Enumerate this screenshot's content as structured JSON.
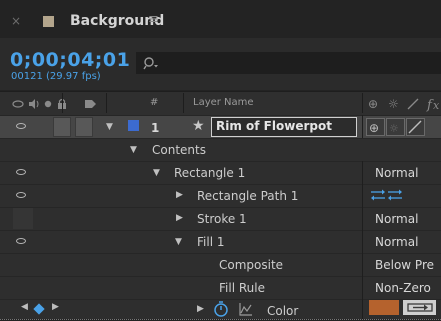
{
  "panel": {
    "close_glyph": "×",
    "title": "Background",
    "menu_glyph": "≡"
  },
  "timecode": {
    "current": "0;00;04;01",
    "frames": "00121 (29.97 fps)"
  },
  "search": {
    "icon": "search-icon",
    "glyph": "⌕"
  },
  "columns": {
    "layer_name": "Layer Name",
    "number_hash": "#"
  },
  "layer": {
    "number": "1",
    "name": "Rim of Flowerpot"
  },
  "rows": {
    "contents": "Contents",
    "rect1": "Rectangle 1",
    "rect_path": "Rectangle Path 1",
    "stroke1": "Stroke 1",
    "fill1": "Fill 1",
    "composite": "Composite",
    "fill_rule": "Fill Rule",
    "color": "Color"
  },
  "values": {
    "rect1_mode": "Normal",
    "stroke1_mode": "Normal",
    "fill1_mode": "Normal",
    "composite_value": "Below Pre",
    "fill_rule_value": "Non-Zero"
  },
  "colors": {
    "accent": "#4aa2e8",
    "fill_color": "#b5622d",
    "label_blue": "#3c6bd0",
    "tab_label": "#b3a58c"
  }
}
